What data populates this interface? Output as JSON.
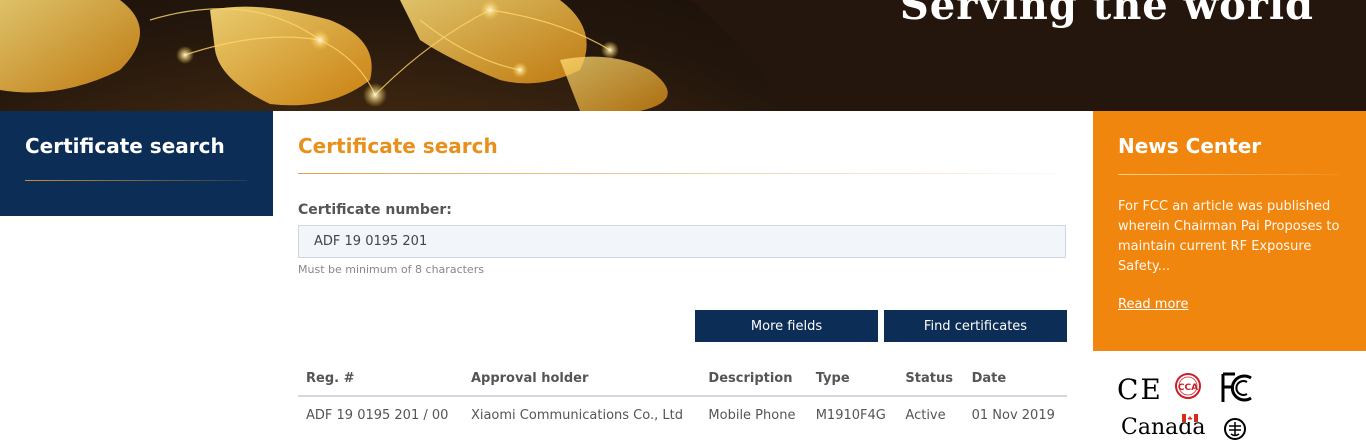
{
  "hero": {
    "tagline": "Serving the world"
  },
  "sidebar": {
    "title": "Certificate search"
  },
  "main": {
    "title": "Certificate search",
    "field_label": "Certificate number:",
    "field_value": "ADF 19 0195 201",
    "hint": "Must be minimum of 8 characters",
    "buttons": {
      "more_fields": "More fields",
      "find_certificates": "Find certificates"
    },
    "table": {
      "headers": [
        "Reg. #",
        "Approval holder",
        "Description",
        "Type",
        "Status",
        "Date"
      ],
      "rows": [
        [
          "ADF 19 0195 201 / 00",
          "Xiaomi Communications Co., Ltd",
          "Mobile Phone",
          "M1910F4G",
          "Active",
          "01 Nov 2019"
        ]
      ]
    }
  },
  "news": {
    "title": "News Center",
    "body": "For FCC an article was published wherein Chairman Pai Proposes to maintain current RF Exposure Safety...",
    "read_more": "Read more"
  },
  "logos": {
    "ce": "CE",
    "ccc": "CCA",
    "fc": "FC",
    "canada": "Canada"
  },
  "colors": {
    "navy": "#0c2d55",
    "orange_text": "#e8901c",
    "orange_panel": "#f0860e"
  }
}
